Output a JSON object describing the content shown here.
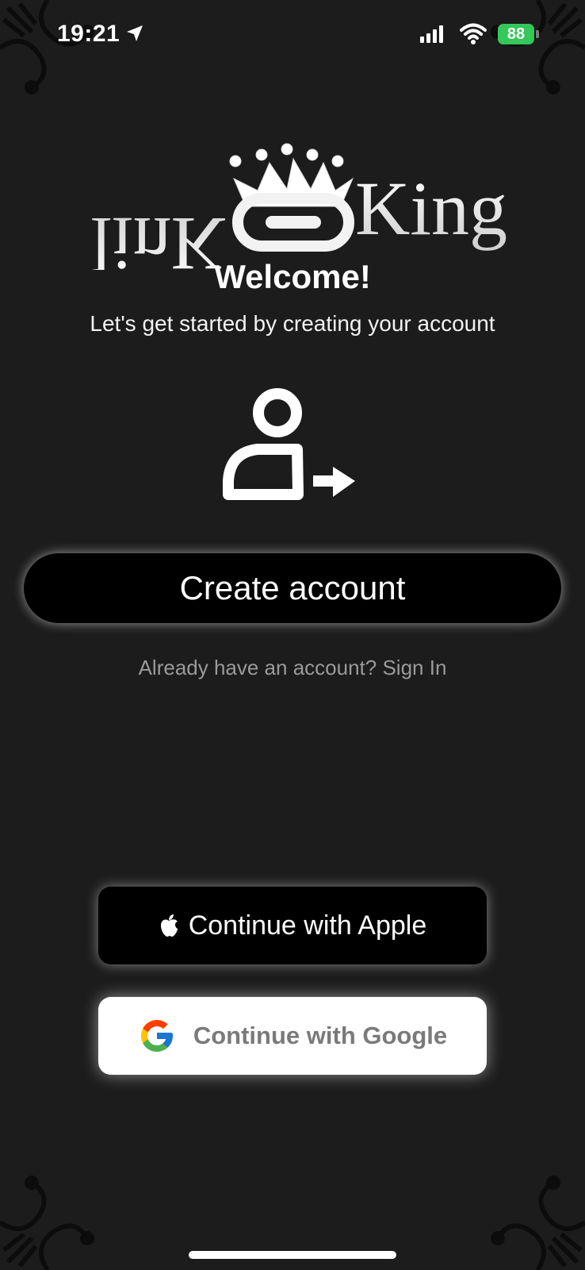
{
  "status_bar": {
    "time": "19:21",
    "battery": "88",
    "icons": [
      "location-arrow-icon",
      "signal-icon",
      "wifi-icon",
      "battery-icon"
    ]
  },
  "logo": {
    "left_text": "linK",
    "right_text": "King"
  },
  "welcome": {
    "title": "Welcome!",
    "subtitle": "Let's get started by creating your account"
  },
  "actions": {
    "create_account": "Create account",
    "sign_in_prompt": "Already have an account? Sign In"
  },
  "social": {
    "apple": "Continue with Apple",
    "google": "Continue with Google"
  },
  "colors": {
    "background": "#1c1c1c",
    "battery": "#34c759",
    "button_dark": "#000000",
    "button_light": "#ffffff",
    "muted_text": "#9a9a9a"
  }
}
